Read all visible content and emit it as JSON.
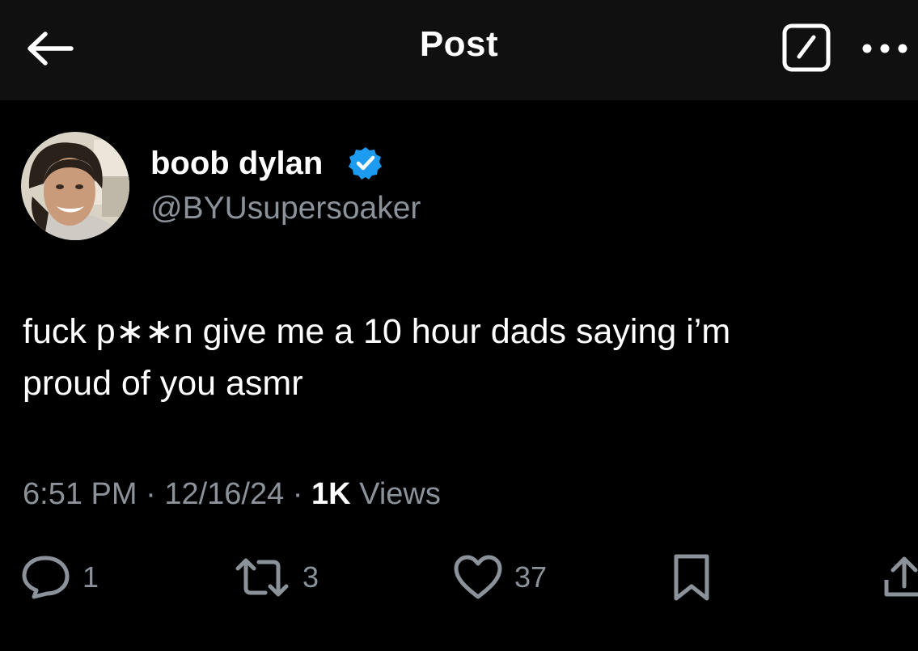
{
  "header": {
    "title": "Post",
    "back_icon": "arrow-left-icon",
    "edit_icon": "edit-square-icon",
    "more_icon": "more-horizontal-icon"
  },
  "author": {
    "display_name": "boob dylan",
    "handle": "@BYUsupersoaker",
    "verified": true,
    "verified_color": "#1d9bf0"
  },
  "post": {
    "text_line1": "fuck p∗∗n give me a 10 hour dads saying i’m",
    "text_line2": "proud of you asmr",
    "time": "6:51 PM",
    "date": "12/16/24",
    "views_count": "1K",
    "views_label": "Views"
  },
  "actions": {
    "replies": "1",
    "reposts": "3",
    "likes": "37"
  },
  "colors": {
    "background": "#000000",
    "header_bg": "#101010",
    "secondary_text": "#8b9299"
  }
}
